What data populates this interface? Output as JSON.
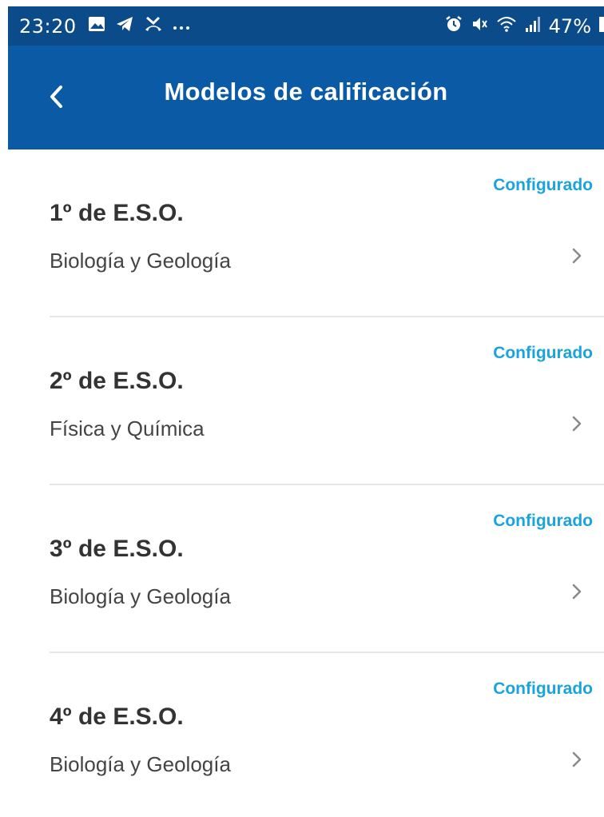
{
  "status_bar": {
    "time": "23:20",
    "left_icons": [
      "image-icon",
      "telegram-icon",
      "missed-call-icon",
      "more-dots-icon"
    ],
    "right_icons": [
      "alarm-icon",
      "mute-icon",
      "wifi-icon",
      "signal-icon",
      "battery-icon"
    ],
    "battery": "47%"
  },
  "app_bar": {
    "title": "Modelos de calificación",
    "back_icon": "chevron-left-icon"
  },
  "items": [
    {
      "status": "Configurado",
      "title": "1º de E.S.O.",
      "subtitle": "Biología y Geología"
    },
    {
      "status": "Configurado",
      "title": "2º de E.S.O.",
      "subtitle": "Física y Química"
    },
    {
      "status": "Configurado",
      "title": "3º de E.S.O.",
      "subtitle": "Biología y Geología"
    },
    {
      "status": "Configurado",
      "title": "4º de E.S.O.",
      "subtitle": "Biología y Geología"
    }
  ],
  "colors": {
    "status_bar_bg": "#0b4b8a",
    "app_bar_bg": "#0b5aa6",
    "status_accent": "#1aa3dc",
    "title_text": "#333333",
    "subtitle_text": "#444444",
    "divider": "#e6e6e6"
  }
}
